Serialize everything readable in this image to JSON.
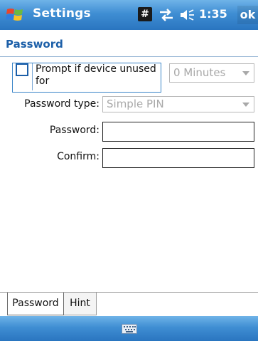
{
  "titlebar": {
    "title": "Settings",
    "status_hash": "#",
    "time": "1:35",
    "ok_label": "ok",
    "start_icon": "windows-flag-icon",
    "connectivity_icon": "connectivity-arrows-icon",
    "volume_icon": "speaker-volume-icon"
  },
  "page": {
    "title": "Password"
  },
  "prompt": {
    "checkbox_checked": false,
    "label": "Prompt if device unused for",
    "minutes_value": "0 Minutes"
  },
  "fields": {
    "password_type_label": "Password type:",
    "password_type_value": "Simple PIN",
    "password_label": "Password:",
    "password_value": "",
    "confirm_label": "Confirm:",
    "confirm_value": ""
  },
  "tabs": [
    {
      "label": "Password",
      "selected": true
    },
    {
      "label": "Hint",
      "selected": false
    }
  ],
  "bottombar": {
    "input_icon": "keyboard-icon"
  },
  "colors": {
    "bar_blue": "#3f8ed3",
    "heading_blue": "#1c5fa8",
    "disabled_text": "#a8a8a8"
  }
}
